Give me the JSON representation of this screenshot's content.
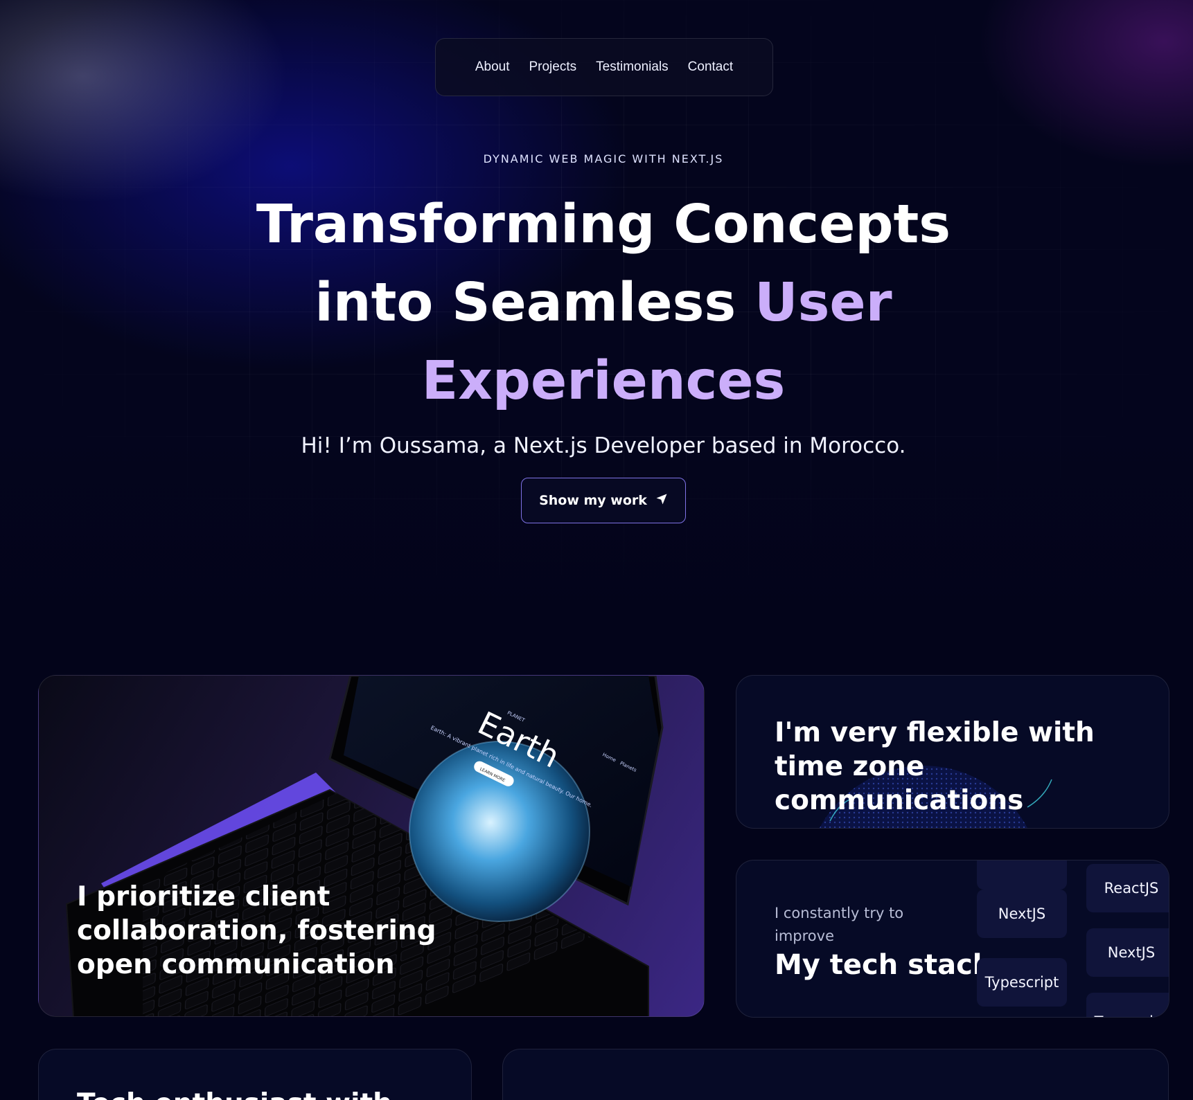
{
  "nav": {
    "items": [
      "About",
      "Projects",
      "Testimonials",
      "Contact"
    ]
  },
  "hero": {
    "kicker": "DYNAMIC WEB MAGIC WITH NEXT.JS",
    "headline_main": "Transforming Concepts into Seamless",
    "headline_accent": "User Experiences",
    "intro": "Hi! I’m Oussama, a Next.js Developer based in Morocco.",
    "cta_label": "Show my work"
  },
  "laptop_screen": {
    "brand": "PLANET",
    "title": "Earth",
    "tagline": "Earth: A vibrant planet rich in life and natural beauty. Our home.",
    "button": "LEARN MORE",
    "nav": [
      "Home",
      "Planets"
    ]
  },
  "cards": {
    "collaboration_title": "I prioritize client collaboration, fostering open communication",
    "timezone_title": "I'm very flexible with time zone communications",
    "stack_sub": "I constantly try to improve",
    "stack_title": "My tech stack",
    "stack_left": [
      "NextJS",
      "Typescript"
    ],
    "stack_right": [
      "ReactJS",
      "NextJS",
      "Typescript"
    ],
    "bottom_title": "Tech enthusiast with"
  },
  "colors": {
    "background": "#03041a",
    "accent": "#cbaefa",
    "cta_border": "#7f72e6"
  }
}
